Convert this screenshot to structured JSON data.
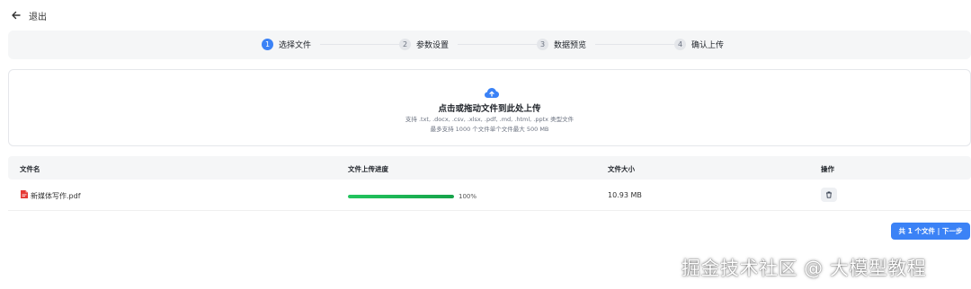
{
  "header": {
    "back_label": "退出"
  },
  "steps": [
    {
      "num": "1",
      "label": "选择文件",
      "active": true
    },
    {
      "num": "2",
      "label": "参数设置",
      "active": false
    },
    {
      "num": "3",
      "label": "数据预览",
      "active": false
    },
    {
      "num": "4",
      "label": "确认上传",
      "active": false
    }
  ],
  "upload": {
    "title": "点击或拖动文件到此处上传",
    "hint_types": "支持 .txt, .docx, .csv, .xlsx, .pdf, .md, .html, .pptx 类型文件",
    "hint_limits": "最多支持 1000 个文件单个文件最大 500 MB"
  },
  "table": {
    "headers": {
      "name": "文件名",
      "progress": "文件上传进度",
      "size": "文件大小",
      "actions": "操作"
    },
    "rows": [
      {
        "name": "新媒体写作.pdf",
        "progress": 1.0,
        "progress_text": "100%",
        "size": "10.93 MB"
      }
    ]
  },
  "footer": {
    "next_label": "共 1 个文件 | 下一步"
  },
  "watermark": "掘金技术社区 @ 大模型教程",
  "colors": {
    "accent": "#3b82f6",
    "progress": "#22c55e",
    "pdf_icon": "#e53935"
  },
  "icons": {
    "back": "arrow-left-icon",
    "upload": "cloud-upload-icon",
    "file": "pdf-file-icon",
    "delete": "trash-icon"
  }
}
